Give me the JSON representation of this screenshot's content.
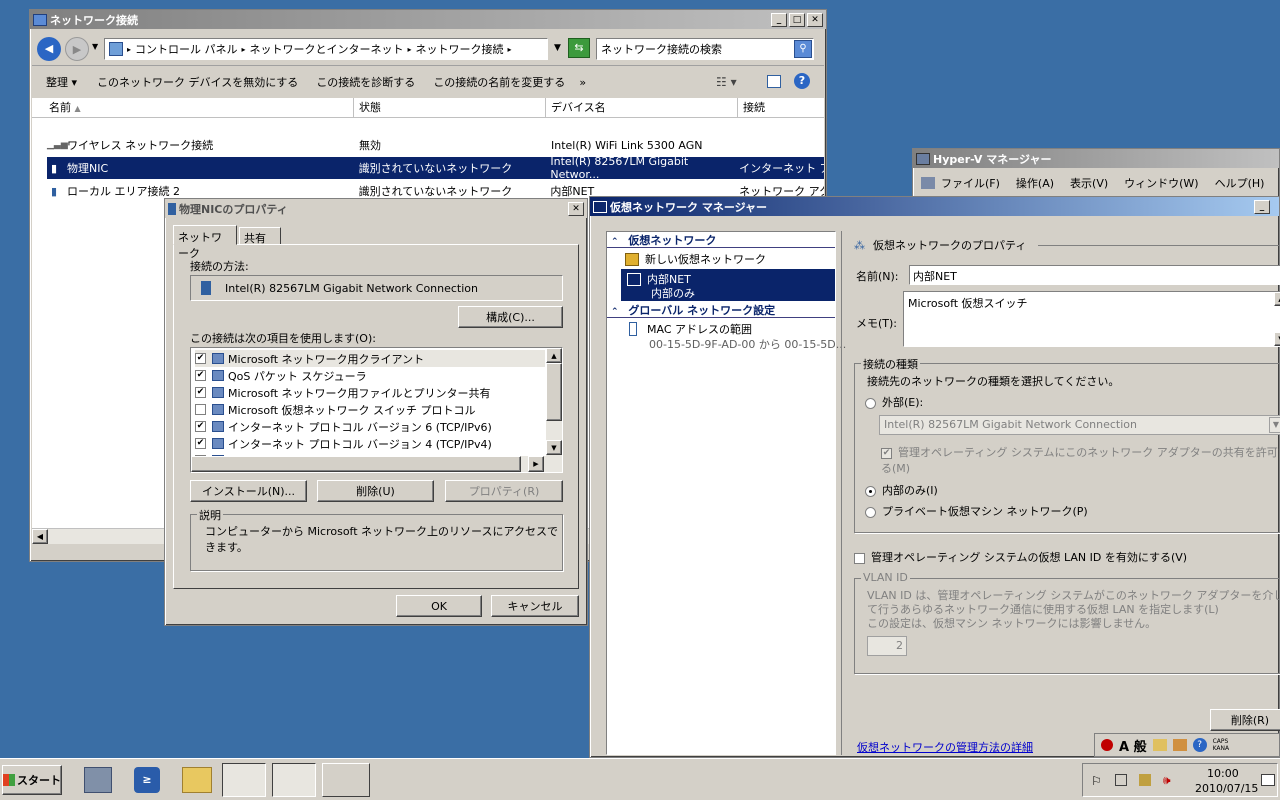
{
  "net_window": {
    "title": "ネットワーク接続",
    "breadcrumb": [
      "コントロール パネル",
      "ネットワークとインターネット",
      "ネットワーク接続"
    ],
    "search_placeholder": "ネットワーク接続の検索",
    "toolbar": {
      "organize": "整理",
      "disable": "このネットワーク デバイスを無効にする",
      "diagnose": "この接続を診断する",
      "rename": "この接続の名前を変更する",
      "more": "»"
    },
    "columns": [
      "名前",
      "状態",
      "デバイス名",
      "接続"
    ],
    "rows": [
      {
        "name": "ワイヤレス ネットワーク接続",
        "status": "無効",
        "device": "Intel(R) WiFi Link 5300 AGN",
        "conn": ""
      },
      {
        "name": "物理NIC",
        "status": "識別されていないネットワーク",
        "device": "Intel(R) 82567LM Gigabit Networ...",
        "conn": "インターネット アク"
      },
      {
        "name": "ローカル エリア接続 2",
        "status": "識別されていないネットワーク",
        "device": "内部NET",
        "conn": "ネットワーク アクセ"
      }
    ]
  },
  "props": {
    "title": "物理NICのプロパティ",
    "tabs": [
      "ネットワーク",
      "共有"
    ],
    "connect_using_label": "接続の方法:",
    "adapter": "Intel(R) 82567LM Gigabit Network Connection",
    "configure": "構成(C)...",
    "items_label": "この接続は次の項目を使用します(O):",
    "items": [
      {
        "label": "Microsoft ネットワーク用クライアント",
        "checked": "✔"
      },
      {
        "label": "QoS パケット スケジューラ",
        "checked": "✔"
      },
      {
        "label": "Microsoft ネットワーク用ファイルとプリンター共有",
        "checked": "✔"
      },
      {
        "label": "Microsoft 仮想ネットワーク スイッチ プロトコル",
        "checked": ""
      },
      {
        "label": "インターネット プロトコル バージョン 6 (TCP/IPv6)",
        "checked": "✔"
      },
      {
        "label": "インターネット プロトコル バージョン 4 (TCP/IPv4)",
        "checked": "✔"
      },
      {
        "label": "Link-Layer Topology Discovery Mapper I/O Driver",
        "checked": "✔"
      }
    ],
    "install": "インストール(N)...",
    "uninstall": "削除(U)",
    "properties": "プロパティ(R)",
    "desc_label": "説明",
    "desc": "コンピューターから Microsoft ネットワーク上のリソースにアクセスできます。",
    "ok": "OK",
    "cancel": "キャンセル"
  },
  "hyperv": {
    "title": "Hyper-V マネージャー",
    "menu": [
      "ファイル(F)",
      "操作(A)",
      "表示(V)",
      "ウィンドウ(W)",
      "ヘルプ(H)"
    ]
  },
  "vnm": {
    "title": "仮想ネットワーク マネージャー",
    "tree": {
      "section1": "仮想ネットワーク",
      "new_net": "新しい仮想ネットワーク",
      "net_name": "内部NET",
      "net_sub": "内部のみ",
      "section2": "グローバル ネットワーク設定",
      "mac": "MAC アドレスの範囲",
      "mac_sub": "00-15-5D-9F-AD-00 から 00-15-5D..."
    },
    "props_header": "仮想ネットワークのプロパティ",
    "name_label": "名前(N):",
    "name_value": "内部NET",
    "memo_label": "メモ(T):",
    "memo_value": "Microsoft 仮想スイッチ",
    "conn_type_label": "接続の種類",
    "conn_type_desc": "接続先のネットワークの種類を選択してください。",
    "external": "外部(E):",
    "external_adapter": "Intel(R) 82567LM Gigabit Network Connection",
    "allow_share": "管理オペレーティング システムにこのネットワーク アダプターの共有を許可する(M)",
    "internal": "内部のみ(I)",
    "private": "プライベート仮想マシン ネットワーク(P)",
    "vlan_enable": "管理オペレーティング システムの仮想 LAN ID を有効にする(V)",
    "vlan_label": "VLAN ID",
    "vlan_desc": "VLAN ID は、管理オペレーティング システムがこのネットワーク アダプターを介して行うあらゆるネットワーク通信に使用する仮想 LAN を指定します(L)",
    "vlan_desc2": "この設定は、仮想マシン ネットワークには影響しません。",
    "vlan_value": "2",
    "delete": "削除(R)",
    "link": "仮想ネットワークの管理方法の詳細"
  },
  "taskbar": {
    "start": "スタート",
    "time": "10:00",
    "date": "2010/07/15",
    "ime_mode": "A 般",
    "caps": "CAPS",
    "kana": "KANA"
  },
  "colors": {
    "desktop": "#3a6ea5",
    "title_active": "#0a246a",
    "selection": "#0a246a"
  }
}
